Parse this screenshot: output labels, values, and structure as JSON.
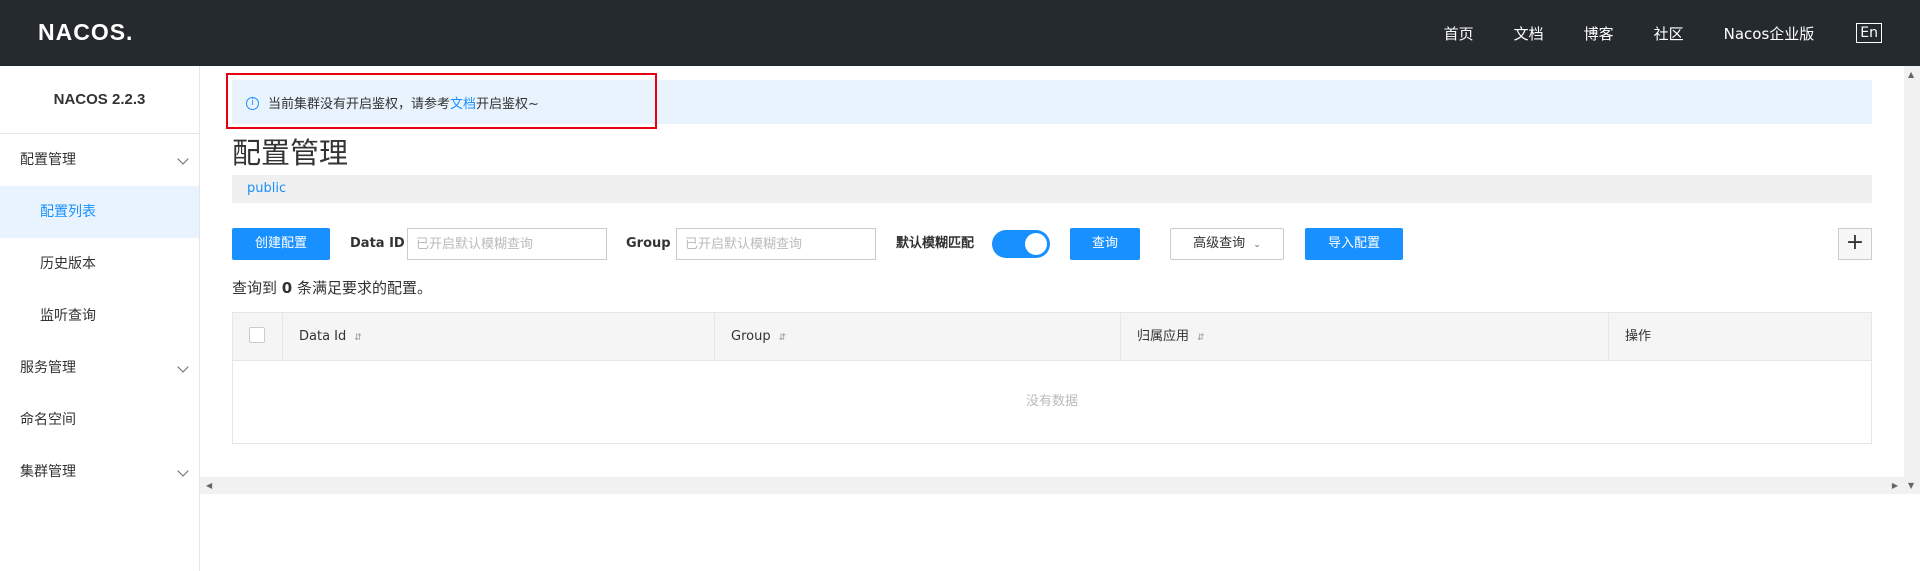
{
  "header": {
    "logo": "NACOS.",
    "nav": [
      "首页",
      "文档",
      "博客",
      "社区",
      "Nacos企业版"
    ],
    "lang": "En"
  },
  "sidebar": {
    "version": "NACOS 2.2.3",
    "items": [
      {
        "label": "配置管理"
      },
      {
        "label": "配置列表"
      },
      {
        "label": "历史版本"
      },
      {
        "label": "监听查询"
      },
      {
        "label": "服务管理"
      },
      {
        "label": "命名空间"
      },
      {
        "label": "集群管理"
      }
    ]
  },
  "notice": {
    "text_before": "当前集群没有开启鉴权，请参考",
    "link": "文档",
    "text_after": "开启鉴权~"
  },
  "page": {
    "title": "配置管理",
    "namespace": "public"
  },
  "toolbar": {
    "create_label": "创建配置",
    "dataid_label": "Data ID",
    "dataid_placeholder": "已开启默认模糊查询",
    "group_label": "Group",
    "group_placeholder": "已开启默认模糊查询",
    "fuzzy_label": "默认模糊匹配",
    "fuzzy_on": true,
    "query_label": "查询",
    "advanced_label": "高级查询",
    "import_label": "导入配置",
    "plus": "+"
  },
  "result": {
    "prefix": "查询到",
    "count": "0",
    "suffix": "条满足要求的配置。"
  },
  "table": {
    "columns": [
      "Data Id",
      "Group",
      "归属应用",
      "操作"
    ],
    "empty": "没有数据"
  },
  "colors": {
    "accent": "#1890ff",
    "header_bg": "#252a2f",
    "highlight_box": "#e60012"
  }
}
